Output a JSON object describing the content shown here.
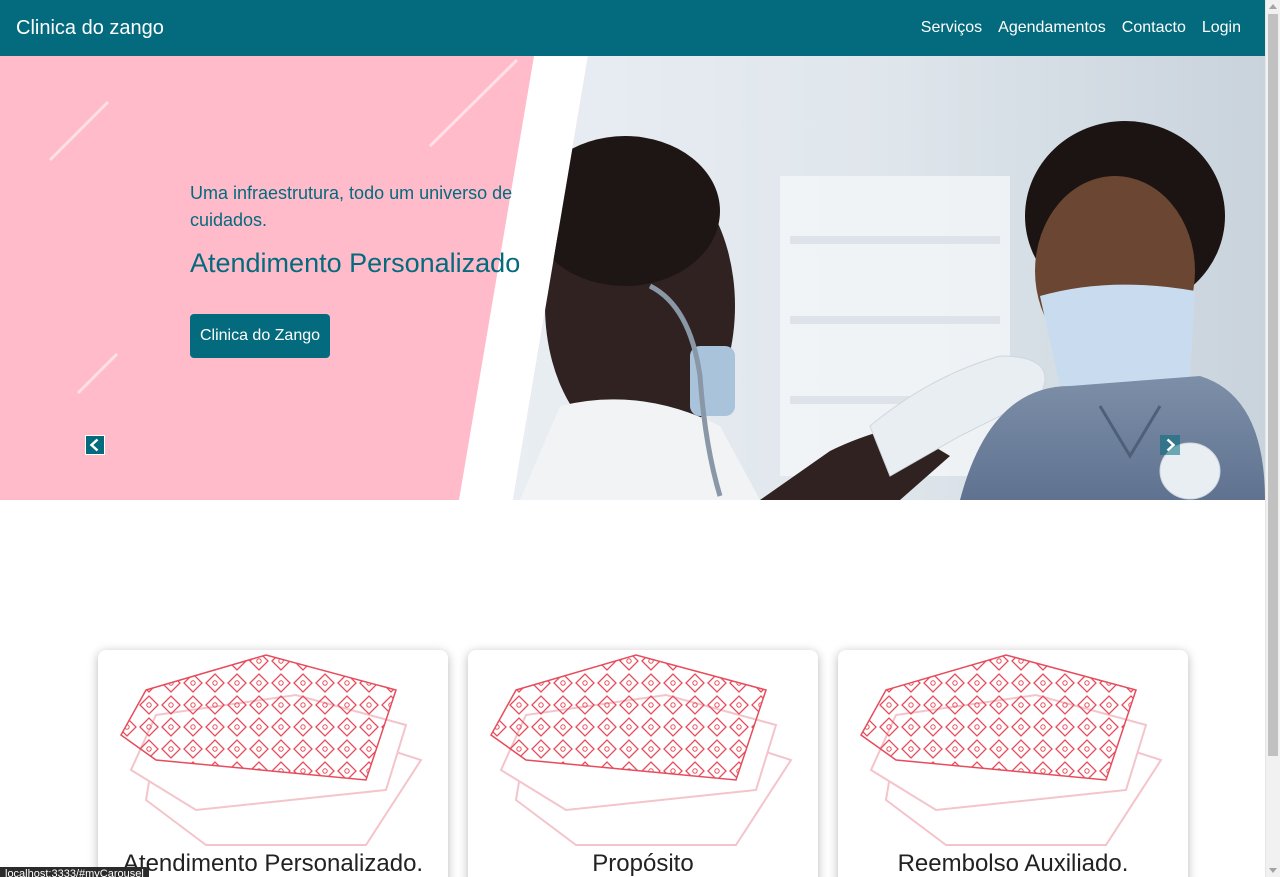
{
  "navbar": {
    "brand": "Clinica do zango",
    "links": [
      {
        "label": "Serviços"
      },
      {
        "label": "Agendamentos"
      },
      {
        "label": "Contacto"
      },
      {
        "label": "Login"
      }
    ],
    "background_color": "#036b7d"
  },
  "carousel": {
    "tagline": "Uma infraestrutura, todo um universo de cuidados.",
    "headline": "Atendimento Personalizado",
    "button_label": "Clinica do Zango",
    "prev_icon": "chevron-left-icon",
    "next_icon": "chevron-right-icon",
    "panel_color": "#ffbbc9",
    "accent_color": "#036b7d"
  },
  "cards": [
    {
      "title": "Atendimento Personalizado.",
      "image": "layered-pattern-tiles"
    },
    {
      "title": "Propósito",
      "image": "layered-pattern-tiles"
    },
    {
      "title": "Reembolso Auxiliado.",
      "image": "layered-pattern-tiles"
    }
  ],
  "status_bar": {
    "url": "localhost:3333/#myCarousel"
  }
}
